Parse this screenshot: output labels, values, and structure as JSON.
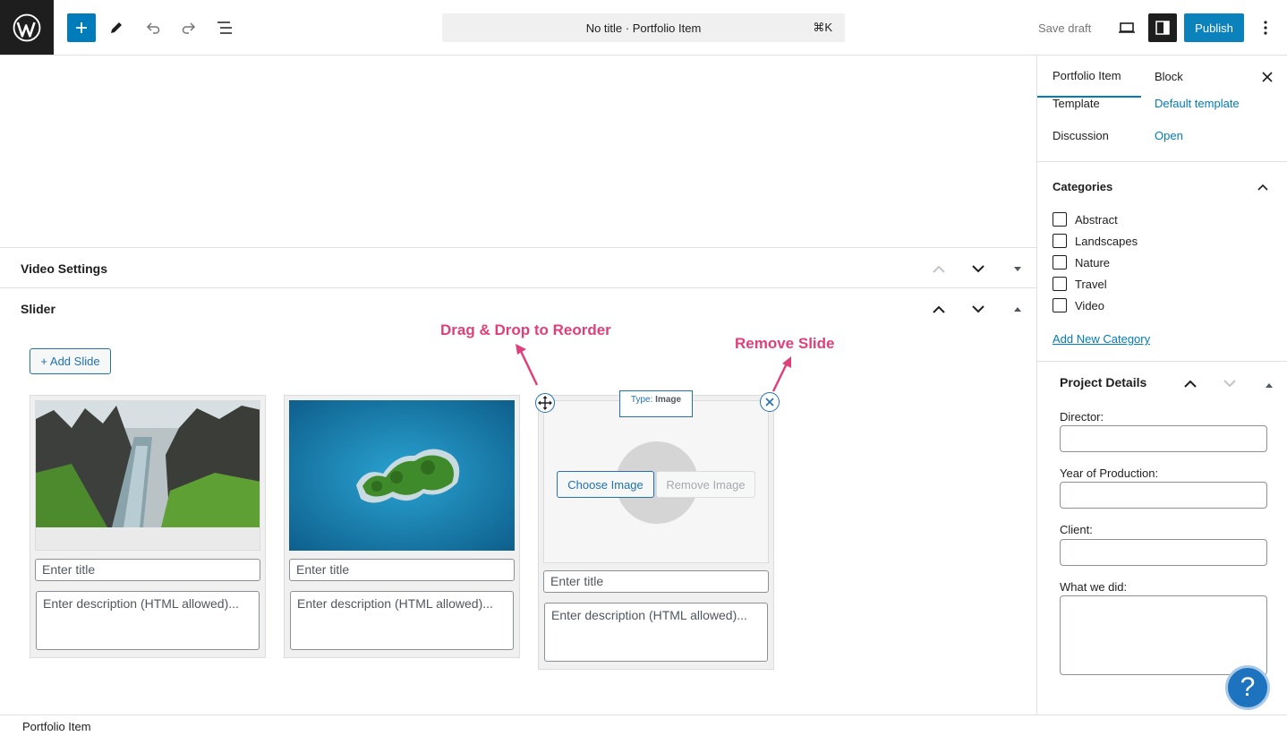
{
  "topbar": {
    "logo": "wordpress-logo",
    "command_bar": "No title · Portfolio Item",
    "shortcut": "⌘K",
    "save_draft": "Save draft",
    "publish": "Publish"
  },
  "metaboxes": {
    "video_settings": "Video Settings",
    "slider": "Slider"
  },
  "slider": {
    "add_slide": "+ Add Slide",
    "annotation_drag": "Drag & Drop to Reorder",
    "annotation_remove": "Remove Slide",
    "type_label": "Type:",
    "type_value": "Image",
    "choose_image": "Choose Image",
    "remove_image": "Remove Image",
    "slides": [
      {
        "title_placeholder": "Enter title",
        "desc_placeholder": "Enter description (HTML allowed)..."
      },
      {
        "title_placeholder": "Enter title",
        "desc_placeholder": "Enter description (HTML allowed)..."
      },
      {
        "title_placeholder": "Enter title",
        "desc_placeholder": "Enter description (HTML allowed)..."
      }
    ]
  },
  "sidebar": {
    "tabs": [
      "Portfolio Item",
      "Block"
    ],
    "template_label": "Template",
    "template_value": "Default template",
    "discussion_label": "Discussion",
    "discussion_value": "Open",
    "categories_heading": "Categories",
    "categories": [
      "Abstract",
      "Landscapes",
      "Nature",
      "Travel",
      "Video"
    ],
    "add_category": "Add New Category",
    "project_details_heading": "Project Details",
    "fields": [
      "Director:",
      "Year of Production:",
      "Client:",
      "What we did:"
    ]
  },
  "help": "?",
  "footer": "Portfolio Item",
  "colors": {
    "accent": "#007cba",
    "annotation": "#e0407a",
    "dark": "#1e1e1e"
  }
}
